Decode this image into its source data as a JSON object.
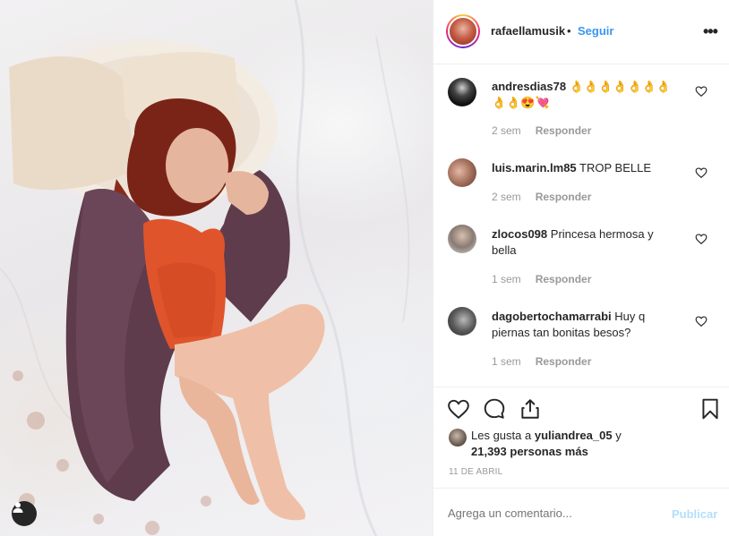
{
  "post": {
    "owner": "rafaellamusik",
    "separator": "•",
    "follow_label": "Seguir",
    "more_label": "•••"
  },
  "comments": [
    {
      "user": "andresdias78",
      "text": "👌👌👌👌👌👌👌👌👌😍💘",
      "time": "2 sem",
      "reply_label": "Responder"
    },
    {
      "user": "luis.marin.lm85",
      "text": "TROP BELLE",
      "time": "2 sem",
      "reply_label": "Responder"
    },
    {
      "user": "zlocos098",
      "text": "Princesa hermosa y bella",
      "time": "1 sem",
      "reply_label": "Responder"
    },
    {
      "user": "dagobertochamarrabi",
      "text": "Huy q piernas tan bonitas besos?",
      "time": "1 sem",
      "reply_label": "Responder"
    }
  ],
  "likes": {
    "prefix": "Les gusta a",
    "user": "yuliandrea_05",
    "conjunction": "y",
    "others": "21,393 personas más"
  },
  "date": "11 DE ABRIL",
  "add_comment": {
    "placeholder": "Agrega un comentario...",
    "publish_label": "Publicar"
  },
  "icons": {
    "like": "heart-icon",
    "comment": "comment-bubble-icon",
    "share": "share-icon",
    "save": "bookmark-icon",
    "tagged": "user-tag-icon"
  },
  "colors": {
    "link_blue": "#3897f0",
    "publish_disabled": "#b2dffc",
    "muted_text": "#999999",
    "divider": "#efefef"
  }
}
